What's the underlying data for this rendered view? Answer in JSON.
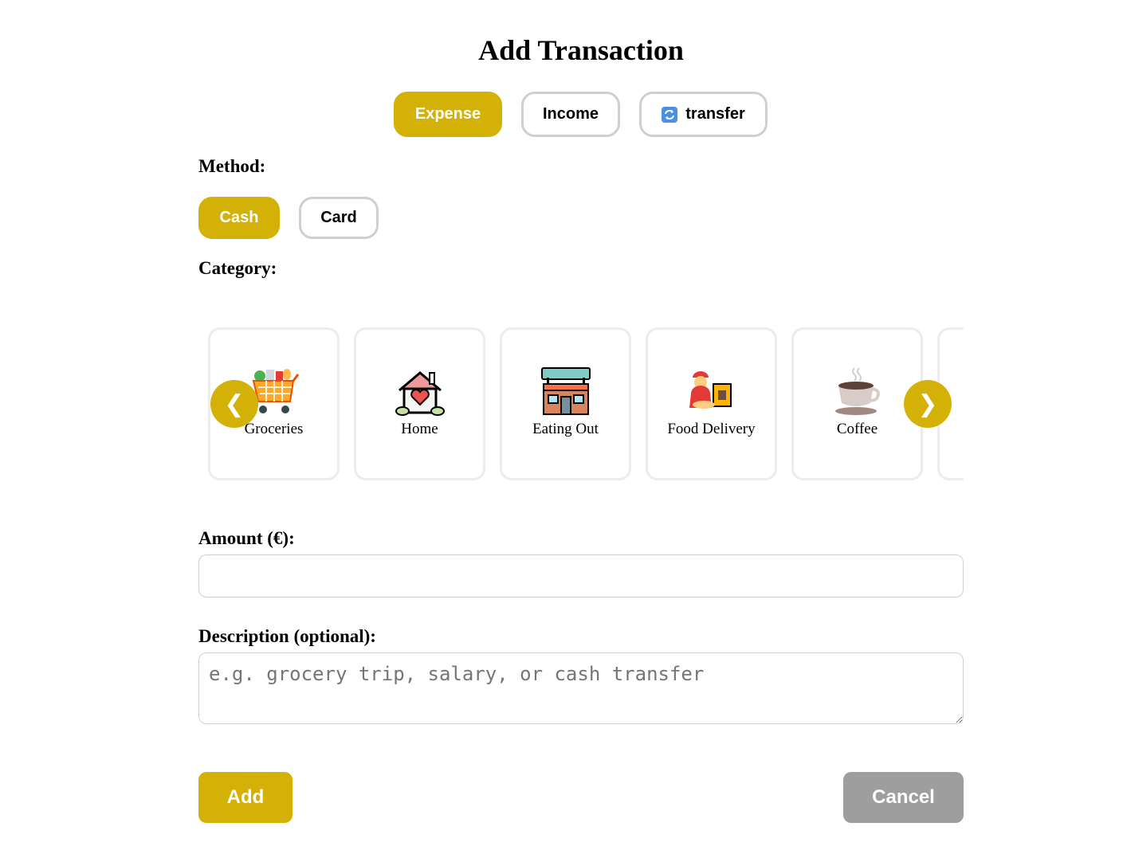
{
  "title": "Add Transaction",
  "type_tabs": [
    {
      "label": "Expense",
      "active": true
    },
    {
      "label": "Income",
      "active": false
    },
    {
      "label": "transfer",
      "active": false,
      "icon": "sync-icon"
    }
  ],
  "method": {
    "label": "Method:",
    "options": [
      {
        "label": "Cash",
        "active": true
      },
      {
        "label": "Card",
        "active": false
      }
    ]
  },
  "category": {
    "label": "Category:",
    "items": [
      {
        "name": "Groceries",
        "icon": "shopping-cart-icon"
      },
      {
        "name": "Home",
        "icon": "house-icon"
      },
      {
        "name": "Eating Out",
        "icon": "restaurant-icon"
      },
      {
        "name": "Food Delivery",
        "icon": "delivery-person-icon"
      },
      {
        "name": "Coffee",
        "icon": "coffee-cup-icon"
      }
    ],
    "prev_arrow": "❮",
    "next_arrow": "❯"
  },
  "amount": {
    "label": "Amount (€):",
    "value": "",
    "placeholder": ""
  },
  "description": {
    "label": "Description (optional):",
    "value": "",
    "placeholder": "e.g. grocery trip, salary, or cash transfer"
  },
  "actions": {
    "add_label": "Add",
    "cancel_label": "Cancel"
  },
  "colors": {
    "accent": "#d4b106",
    "cancel": "#9e9e9e",
    "border": "#cfcfcf"
  }
}
